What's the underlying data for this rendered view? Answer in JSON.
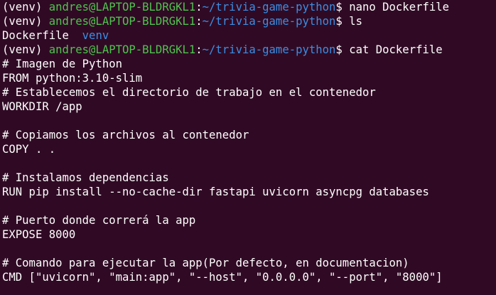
{
  "colors": {
    "background": "#300a24",
    "text": "#ffffff",
    "user_host": "#4ec34e",
    "path": "#3b8ee4"
  },
  "prompts": [
    {
      "venv": "(venv) ",
      "user_host": "andres@LAPTOP-BLDRGKL1",
      "colon": ":",
      "path": "~/trivia-game-python",
      "dollar": "$ ",
      "command": "nano Dockerfile"
    },
    {
      "venv": "(venv) ",
      "user_host": "andres@LAPTOP-BLDRGKL1",
      "colon": ":",
      "path": "~/trivia-game-python",
      "dollar": "$ ",
      "command": "ls"
    },
    {
      "venv": "(venv) ",
      "user_host": "andres@LAPTOP-BLDRGKL1",
      "colon": ":",
      "path": "~/trivia-game-python",
      "dollar": "$ ",
      "command": "cat Dockerfile"
    }
  ],
  "ls_output": {
    "file": "Dockerfile",
    "dir": "venv"
  },
  "dockerfile_lines": [
    "# Imagen de Python",
    "FROM python:3.10-slim",
    "# Establecemos el directorio de trabajo en el contenedor",
    "WORKDIR /app",
    "",
    "# Copiamos los archivos al contenedor",
    "COPY . .",
    "",
    "# Instalamos dependencias",
    "RUN pip install --no-cache-dir fastapi uvicorn asyncpg databases",
    "",
    "# Puerto donde correrá la app",
    "EXPOSE 8000",
    "",
    "# Comando para ejecutar la app(Por defecto, en documentacion)",
    "CMD [\"uvicorn\", \"main:app\", \"--host\", \"0.0.0.0\", \"--port\", \"8000\"]"
  ]
}
